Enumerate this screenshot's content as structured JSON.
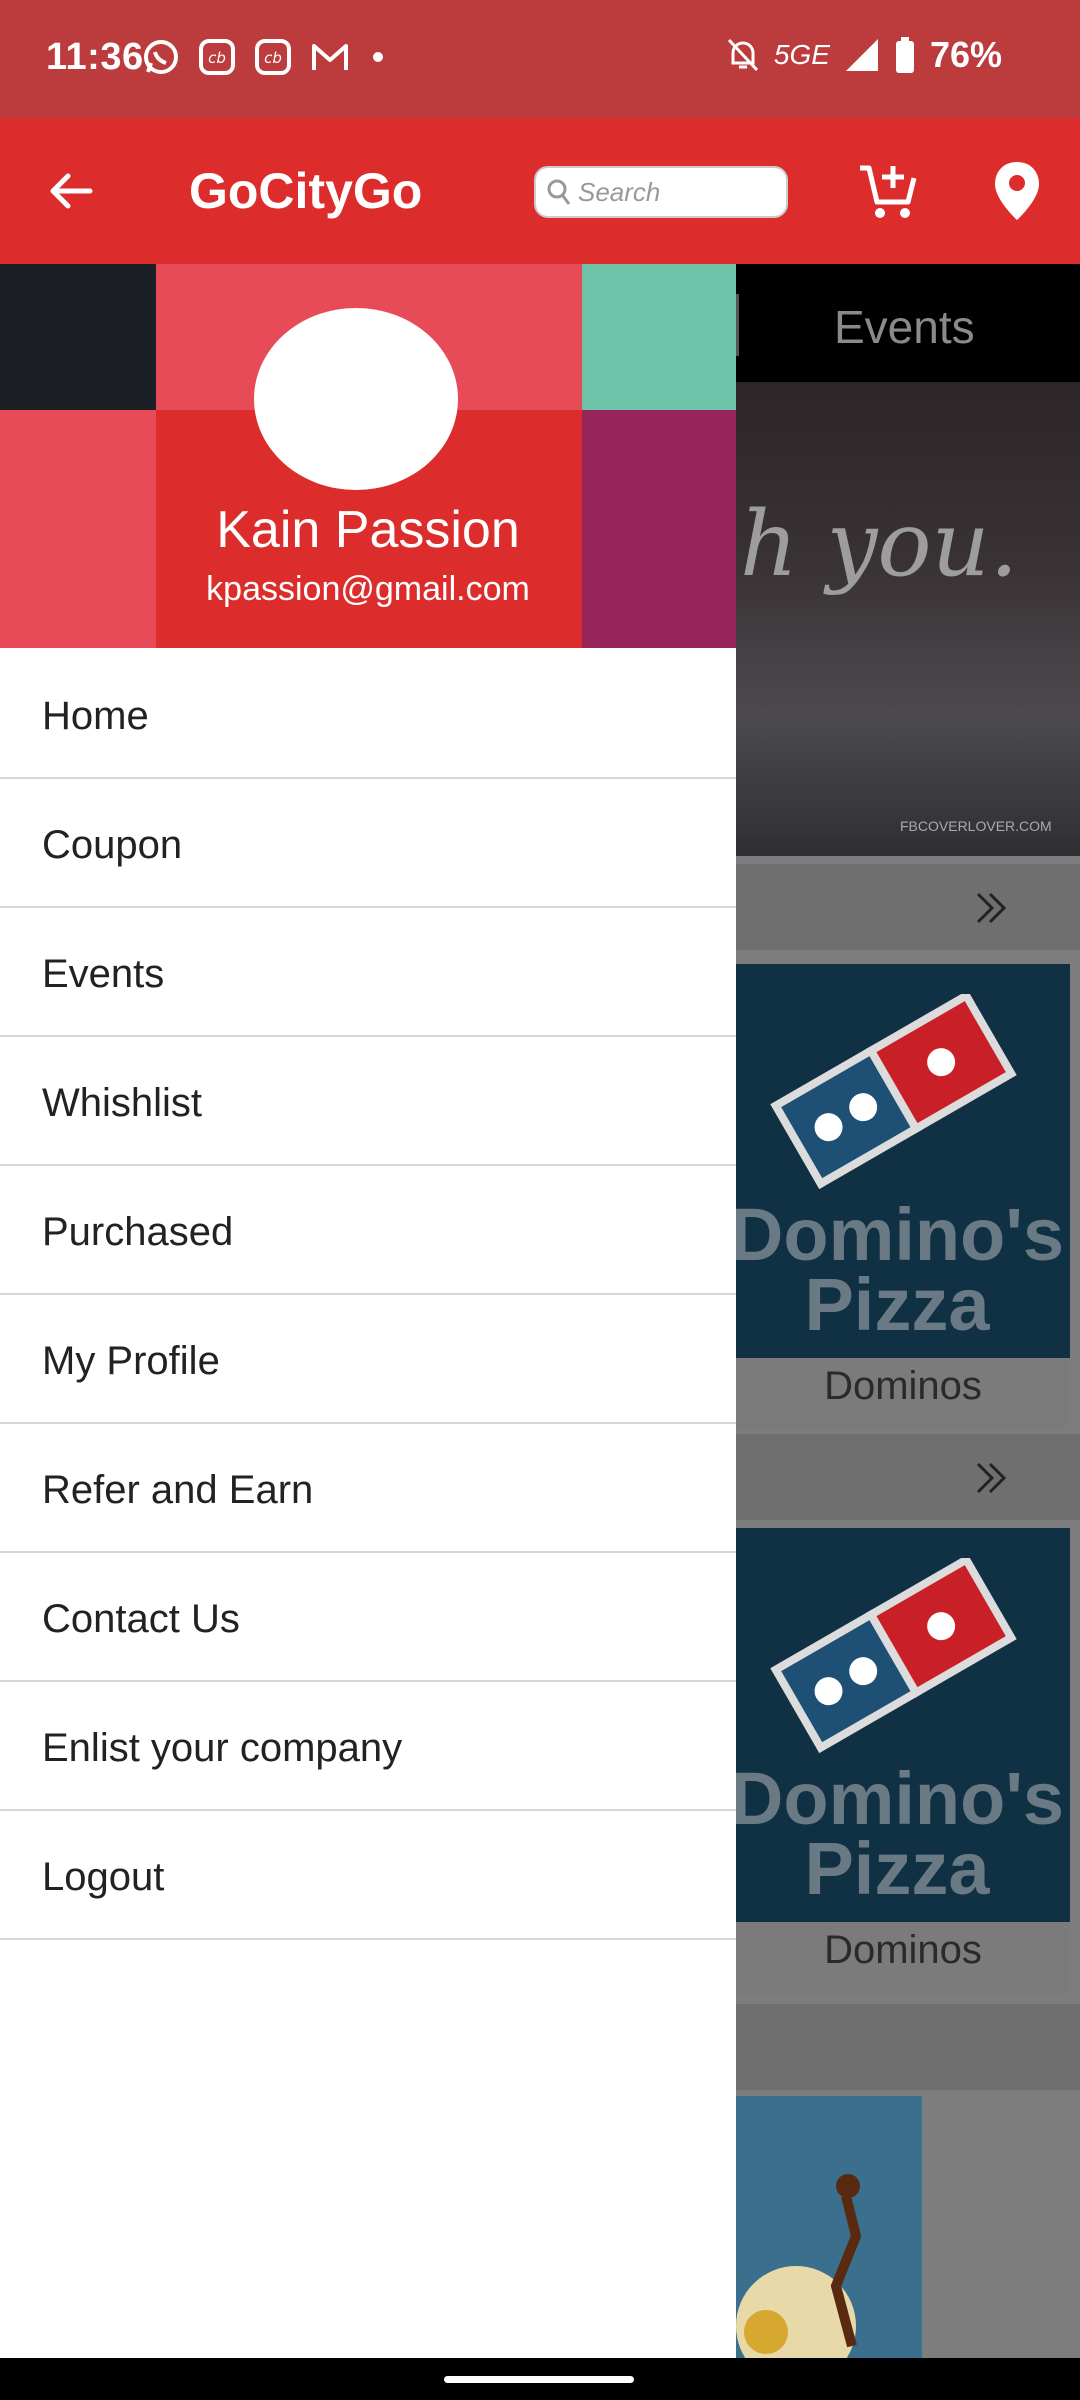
{
  "status_bar": {
    "time": "11:36",
    "network": "5G",
    "network_suffix": "E",
    "battery": "76%"
  },
  "app_bar": {
    "title": "GoCityGo",
    "search_placeholder": "Search"
  },
  "background": {
    "tab_label": "Events",
    "banner_text": "h you.",
    "banner_credit": "FBCOVERLOVER.COM",
    "cards": [
      {
        "brand_line1": "Domino's",
        "brand_line2": "Pizza",
        "label": "Dominos"
      },
      {
        "brand_line1": "Domino's",
        "brand_line2": "Pizza",
        "label": "Dominos"
      }
    ]
  },
  "drawer": {
    "user_name": "Kain Passion",
    "user_email": "kpassion@gmail.com",
    "menu": [
      {
        "label": "Home"
      },
      {
        "label": "Coupon"
      },
      {
        "label": "Events"
      },
      {
        "label": "Whishlist"
      },
      {
        "label": "Purchased"
      },
      {
        "label": "My Profile"
      },
      {
        "label": "Refer and Earn"
      },
      {
        "label": "Contact Us"
      },
      {
        "label": "Enlist your company"
      },
      {
        "label": "Logout"
      }
    ]
  },
  "colors": {
    "status_bar": "#bc3b3c",
    "app_bar": "#dc2d2c",
    "drawer_header": "#dc2d2c",
    "tile_dark": "#1c1f25",
    "tile_pink": "#e64b57",
    "tile_teal": "#6cc3a8",
    "tile_plum": "#97245b"
  }
}
